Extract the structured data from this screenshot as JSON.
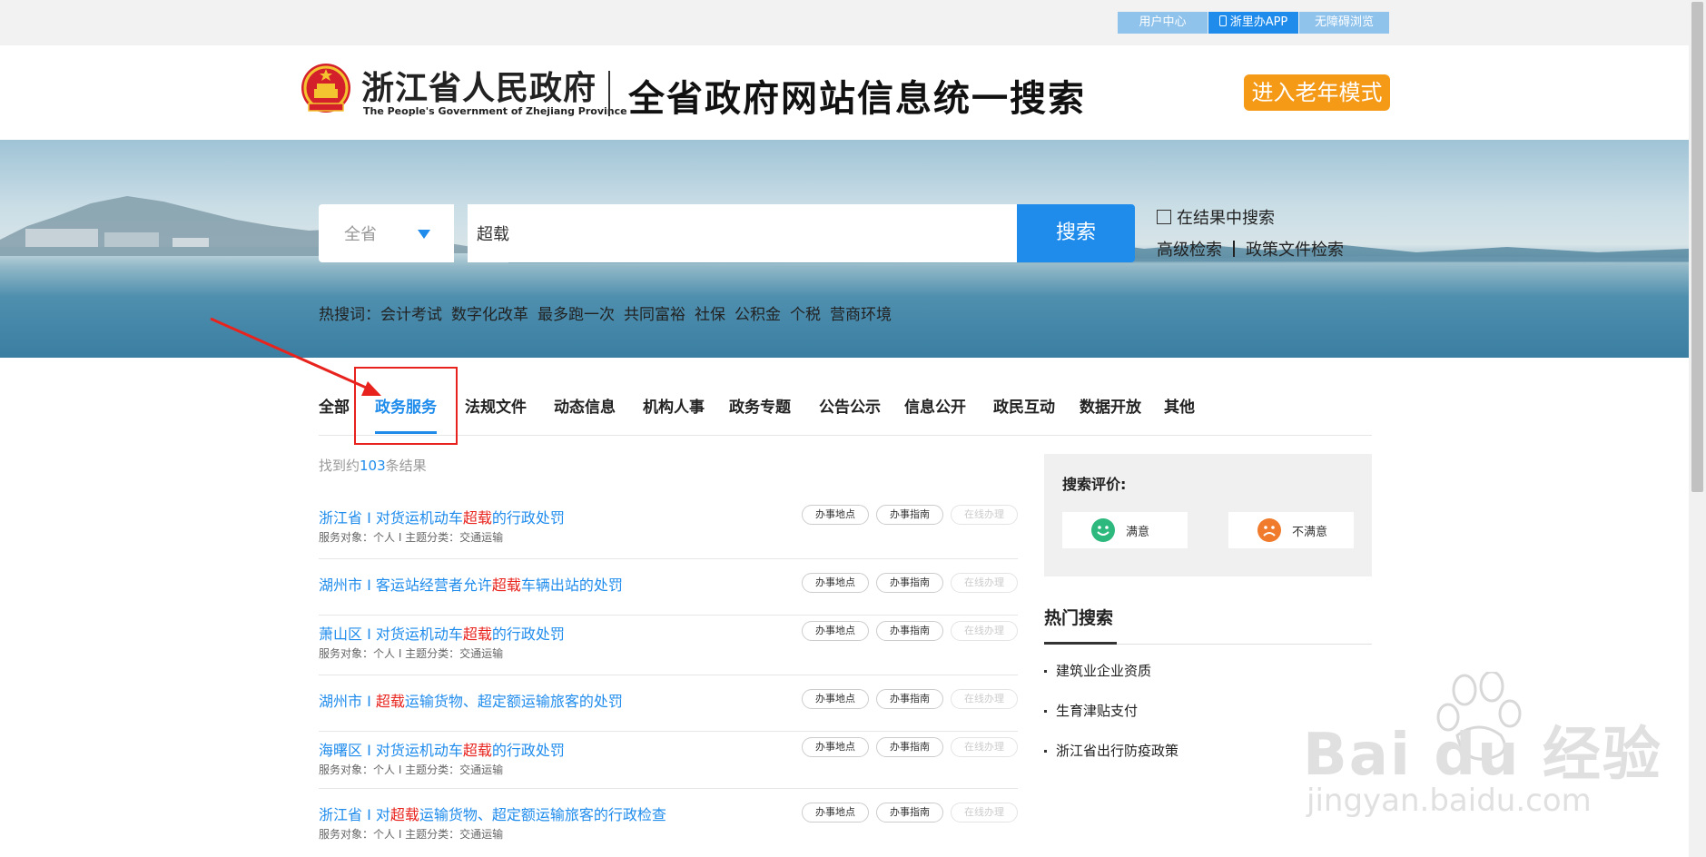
{
  "topbar": {
    "links": [
      "用户中心",
      "浙里办APP",
      "无障碍浏览"
    ]
  },
  "header": {
    "site_name": "浙江省人民政府",
    "site_name_en": "The People's Government of Zhejiang Province",
    "title": "全省政府网站信息统一搜索",
    "elder_mode": "进入老年模式"
  },
  "search": {
    "scope": "全省",
    "query": "超载",
    "button": "搜索",
    "in_result": "在结果中搜索",
    "advanced": "高级检索",
    "policy": "政策文件检索",
    "hot_label": "热搜词：",
    "hot_words": [
      "会计考试",
      "数字化改革",
      "最多跑一次",
      "共同富裕",
      "社保",
      "公积金",
      "个税",
      "营商环境"
    ]
  },
  "tabs": [
    "全部",
    "政务服务",
    "法规文件",
    "动态信息",
    "机构人事",
    "政务专题",
    "公告公示",
    "信息公开",
    "政民互动",
    "数据开放",
    "其他"
  ],
  "active_tab": "政务服务",
  "results": {
    "count_prefix": "找到约",
    "count": "103",
    "count_suffix": "条结果",
    "pill_labels": [
      "办事地点",
      "办事指南",
      "在线办理"
    ],
    "items": [
      {
        "pre": "浙江省 I 对货运机动车",
        "hl": "超载",
        "post": "的行政处罚",
        "meta": "服务对象：个人  I  主题分类：交通运输"
      },
      {
        "pre": "湖州市 I 客运站经营者允许",
        "hl": "超载",
        "post": "车辆出站的处罚",
        "meta": ""
      },
      {
        "pre": "萧山区 I 对货运机动车",
        "hl": "超载",
        "post": "的行政处罚",
        "meta": "服务对象：个人  I  主题分类：交通运输"
      },
      {
        "pre": "湖州市 I ",
        "hl": "超载",
        "post": "运输货物、超定额运输旅客的处罚",
        "meta": ""
      },
      {
        "pre": "海曙区 I 对货运机动车",
        "hl": "超载",
        "post": "的行政处罚",
        "meta": "服务对象：个人  I  主题分类：交通运输"
      },
      {
        "pre": "浙江省 I 对",
        "hl": "超载",
        "post": "运输货物、超定额运输旅客的行政检查",
        "meta": "服务对象：个人  I  主题分类：交通运输"
      }
    ]
  },
  "sidebar": {
    "rating_title": "搜索评价:",
    "satisfied": "满意",
    "unsatisfied": "不满意",
    "satisfied_color": "#2db87d",
    "unsatisfied_color": "#f07b2c",
    "hot_title": "热门搜索",
    "hot_items": [
      "建筑业企业资质",
      "生育津贴支付",
      "浙江省出行防疫政策"
    ]
  },
  "watermark": {
    "brand": "Bai du 经验",
    "url": "jingyan.baidu.com"
  },
  "colors": {
    "accent": "#1f8cec",
    "highlight": "#e8231e",
    "elder": "#f59a17"
  }
}
